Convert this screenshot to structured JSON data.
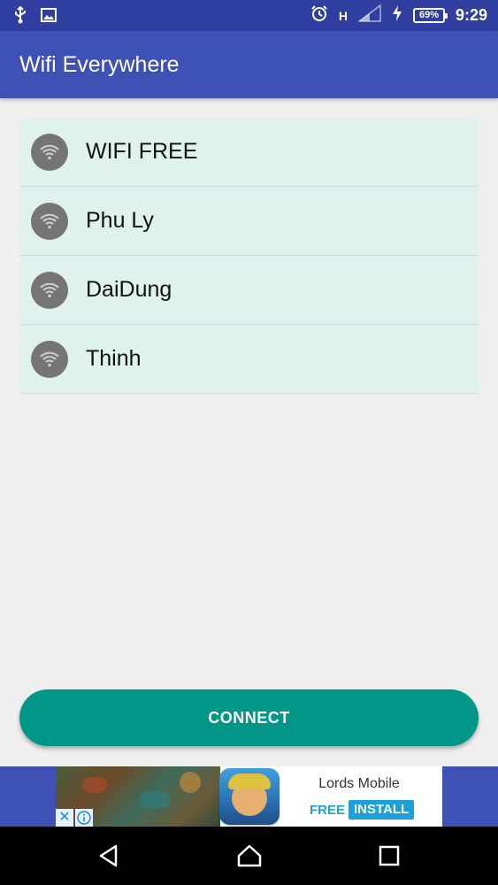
{
  "status_bar": {
    "time": "9:29",
    "battery_percent": "69%",
    "network_type": "H",
    "left_icons": [
      "usb-icon",
      "image-icon"
    ],
    "right_icons": [
      "alarm-icon",
      "signal-icon",
      "charging-icon",
      "battery-icon"
    ]
  },
  "app_bar": {
    "title": "Wifi Everywhere",
    "color": "#3f51b5"
  },
  "wifi_networks": [
    {
      "name": "WIFI FREE",
      "icon": "wifi-icon"
    },
    {
      "name": "Phu Ly",
      "icon": "wifi-icon"
    },
    {
      "name": "DaiDung",
      "icon": "wifi-icon"
    },
    {
      "name": "Thinh",
      "icon": "wifi-icon"
    }
  ],
  "connect_button": {
    "label": "CONNECT",
    "color": "#009688"
  },
  "ad": {
    "title": "Lords Mobile",
    "free_label": "FREE",
    "install_label": "INSTALL",
    "close_symbol": "✕"
  },
  "nav_bar": {
    "icons": [
      "back-icon",
      "home-icon",
      "recents-icon"
    ]
  }
}
